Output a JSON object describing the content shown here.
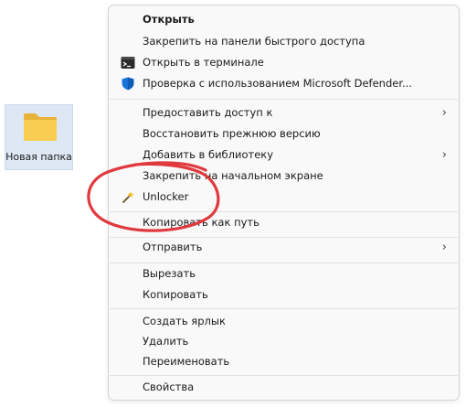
{
  "desktop": {
    "folder_label": "Новая папка"
  },
  "menu": {
    "items": [
      {
        "label": "Открыть",
        "bold": true
      },
      {
        "label": "Закрепить на панели быстрого доступа"
      },
      {
        "label": "Открыть в терминале",
        "icon": "terminal-icon"
      },
      {
        "label": "Проверка с использованием Microsoft Defender...",
        "icon": "defender-shield-icon"
      },
      {
        "label": "Предоставить доступ к",
        "submenu": true
      },
      {
        "label": "Восстановить прежнюю версию"
      },
      {
        "label": "Добавить в библиотеку",
        "submenu": true
      },
      {
        "label": "Закрепить на начальном экране"
      },
      {
        "label": "Unlocker",
        "icon": "unlocker-wand-icon"
      },
      {
        "label": "Копировать как путь"
      },
      {
        "label": "Отправить",
        "submenu": true
      },
      {
        "label": "Вырезать"
      },
      {
        "label": "Копировать"
      },
      {
        "label": "Создать ярлык"
      },
      {
        "label": "Удалить"
      },
      {
        "label": "Переименовать"
      },
      {
        "label": "Свойства"
      }
    ],
    "submenu_glyph": "›"
  },
  "colors": {
    "annotation": "#e0393e",
    "folder_yellow": "#f6c94a",
    "defender_blue": "#1a73d9"
  }
}
